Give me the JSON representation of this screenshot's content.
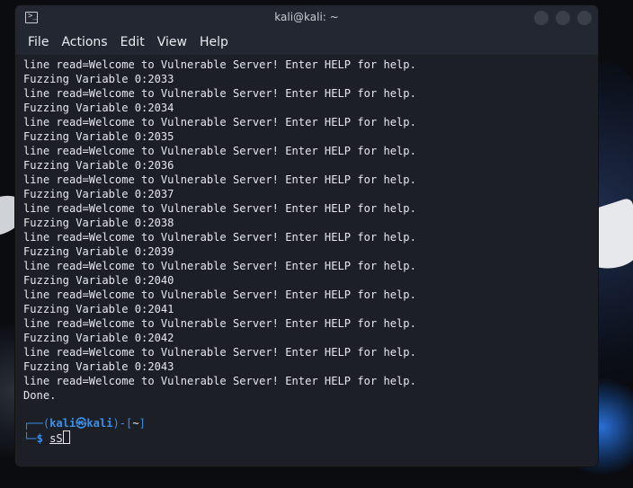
{
  "window": {
    "title": "kali@kali: ~"
  },
  "menu": [
    "File",
    "Actions",
    "Edit",
    "View",
    "Help"
  ],
  "terminal": {
    "lines": [
      "line read=Welcome to Vulnerable Server! Enter HELP for help.",
      "Fuzzing Variable 0:2033",
      "line read=Welcome to Vulnerable Server! Enter HELP for help.",
      "Fuzzing Variable 0:2034",
      "line read=Welcome to Vulnerable Server! Enter HELP for help.",
      "Fuzzing Variable 0:2035",
      "line read=Welcome to Vulnerable Server! Enter HELP for help.",
      "Fuzzing Variable 0:2036",
      "line read=Welcome to Vulnerable Server! Enter HELP for help.",
      "Fuzzing Variable 0:2037",
      "line read=Welcome to Vulnerable Server! Enter HELP for help.",
      "Fuzzing Variable 0:2038",
      "line read=Welcome to Vulnerable Server! Enter HELP for help.",
      "Fuzzing Variable 0:2039",
      "line read=Welcome to Vulnerable Server! Enter HELP for help.",
      "Fuzzing Variable 0:2040",
      "line read=Welcome to Vulnerable Server! Enter HELP for help.",
      "Fuzzing Variable 0:2041",
      "line read=Welcome to Vulnerable Server! Enter HELP for help.",
      "Fuzzing Variable 0:2042",
      "line read=Welcome to Vulnerable Server! Enter HELP for help.",
      "Fuzzing Variable 0:2043",
      "line read=Welcome to Vulnerable Server! Enter HELP for help.",
      "Done."
    ],
    "prompt": {
      "open": "┌──(",
      "user": "kali",
      "at": "㉿",
      "host": "kali",
      "mid": ")-[",
      "dir": "~",
      "close": "]",
      "line2": "└─",
      "dollar": "$",
      "typed": "sS"
    }
  },
  "colors": {
    "prompt_blue": "#3d8fe6",
    "text": "#e6e8eb",
    "background": "#1c1f26"
  },
  "icons": [
    "terminal-icon",
    "minimize-icon",
    "maximize-icon",
    "close-icon"
  ]
}
